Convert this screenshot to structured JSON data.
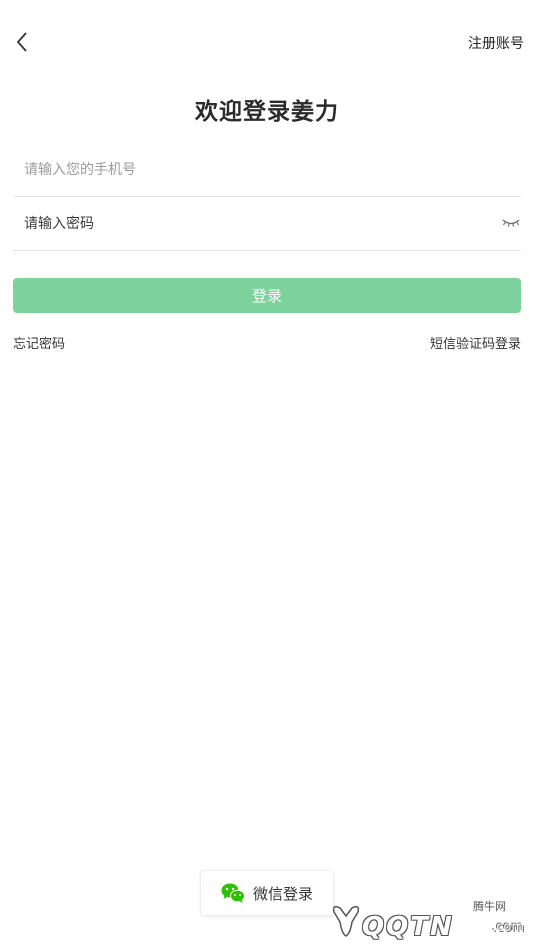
{
  "header": {
    "back_icon": "chevron-left-icon",
    "register_label": "注册账号"
  },
  "title": "欢迎登录姜力",
  "form": {
    "phone_placeholder": "请输入您的手机号",
    "phone_value": "",
    "password_placeholder": "请输入密码",
    "password_value": "",
    "eye_icon": "eye-closed-icon",
    "login_label": "登录",
    "login_color": "#7ed29c"
  },
  "links": {
    "forgot_label": "忘记密码",
    "sms_login_label": "短信验证码登录"
  },
  "wechat": {
    "icon": "wechat-icon",
    "label": "微信登录",
    "icon_color": "#2dc100"
  },
  "watermark": {
    "small_text": "腾牛网",
    "big_text": "QQTN",
    "suffix": ".com"
  }
}
